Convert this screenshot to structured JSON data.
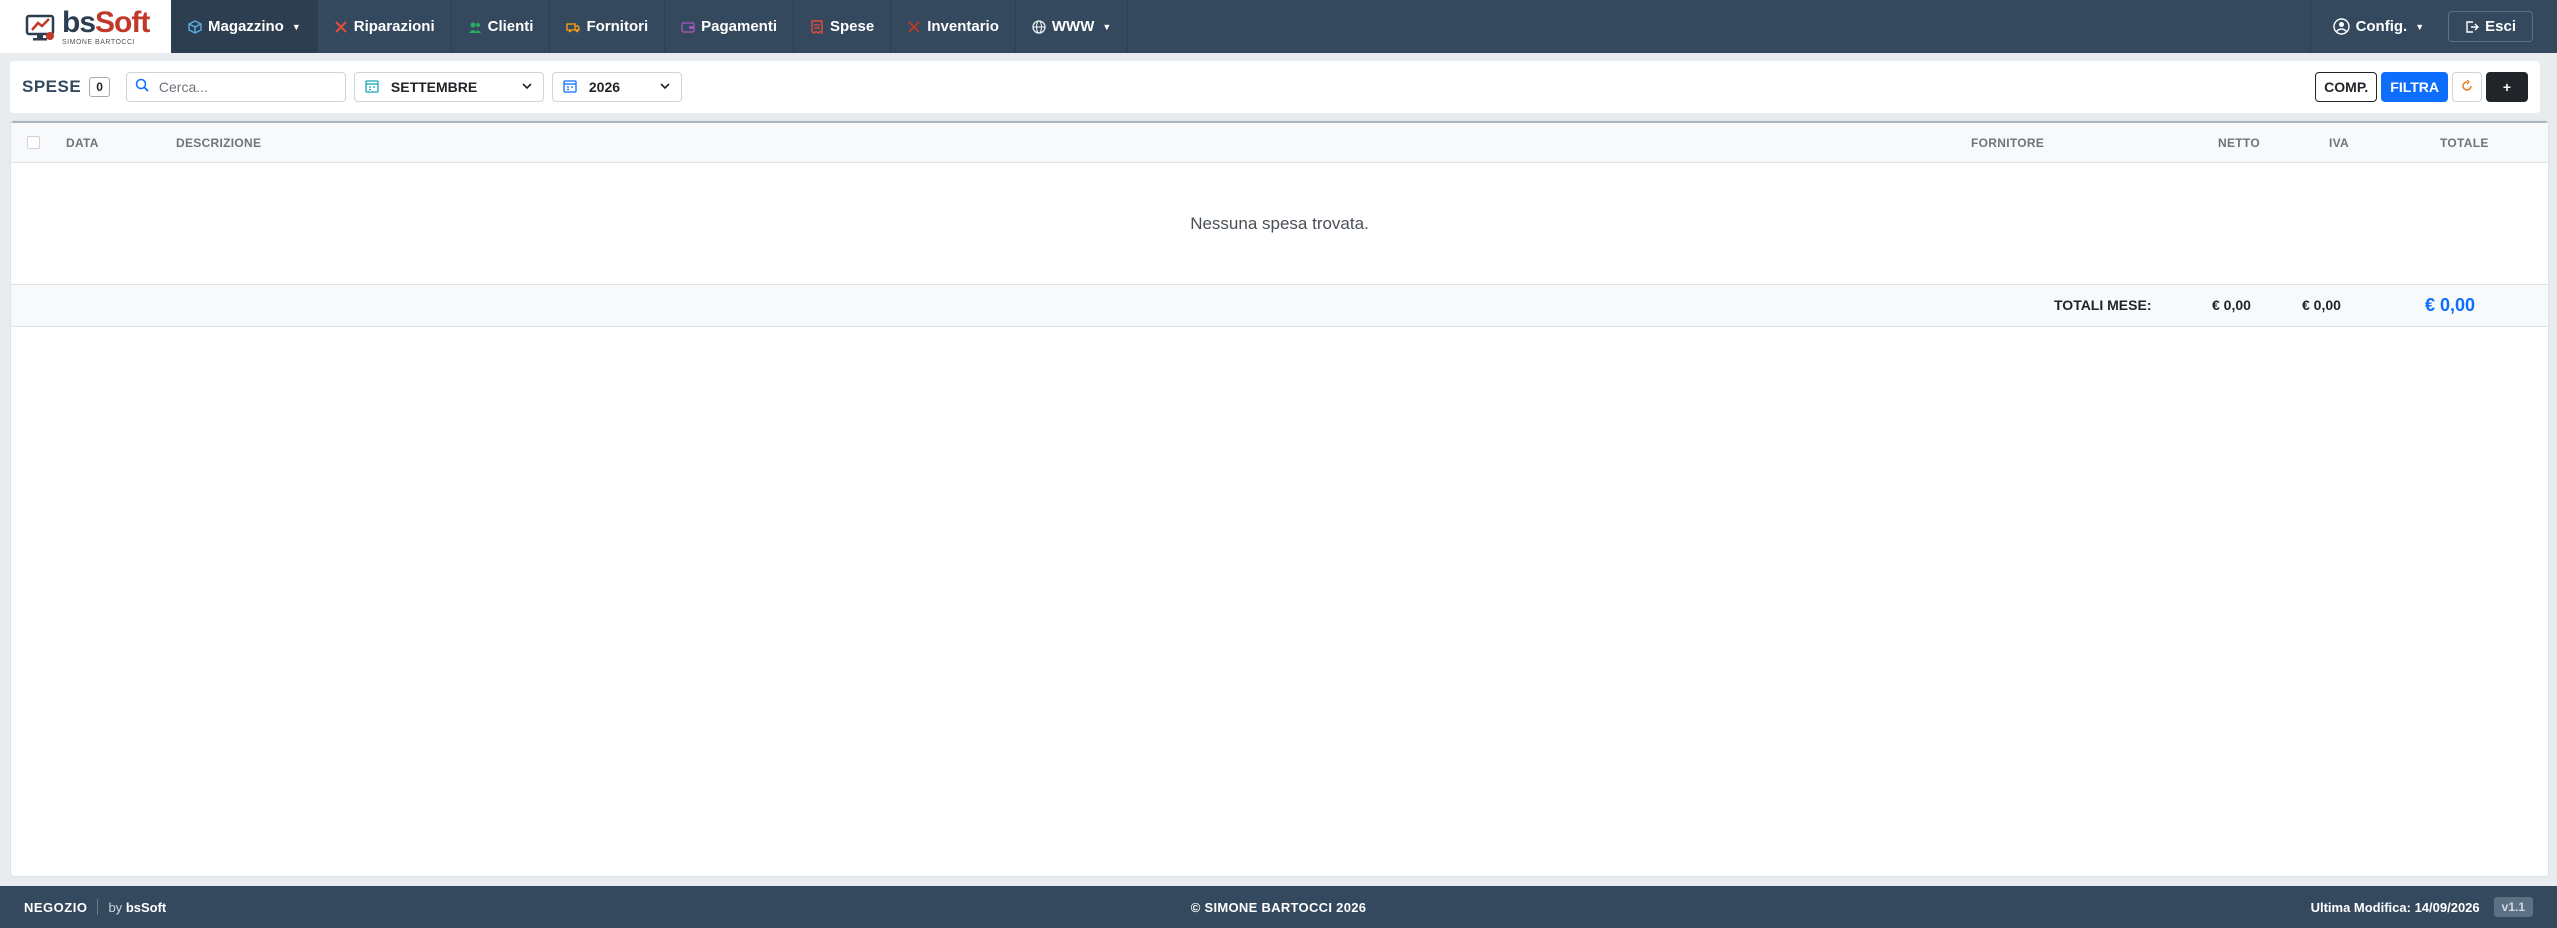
{
  "brand": {
    "name_bs": "bs",
    "name_soft": "Soft",
    "subtitle": "SIMONE BARTOCCI"
  },
  "nav": {
    "items": [
      {
        "label": "Magazzino",
        "icon": "box-icon",
        "color": "#5dade2",
        "caret": true
      },
      {
        "label": "Riparazioni",
        "icon": "tools-icon",
        "color": "#e74c3c",
        "caret": false
      },
      {
        "label": "Clienti",
        "icon": "people-icon",
        "color": "#27ae60",
        "caret": false
      },
      {
        "label": "Fornitori",
        "icon": "truck-icon",
        "color": "#f39c12",
        "caret": false
      },
      {
        "label": "Pagamenti",
        "icon": "wallet-icon",
        "color": "#9b59b6",
        "caret": false
      },
      {
        "label": "Spese",
        "icon": "receipt-icon",
        "color": "#e74c3c",
        "caret": false
      },
      {
        "label": "Inventario",
        "icon": "clipboard-icon",
        "color": "#c0392b",
        "caret": false
      },
      {
        "label": "WWW",
        "icon": "globe-icon",
        "color": "#ecf0f1",
        "caret": true
      }
    ],
    "config_label": "Config.",
    "logout_label": "Esci"
  },
  "toolbar": {
    "title": "SPESE",
    "count": "0",
    "search_placeholder": "Cerca...",
    "month": "SETTEMBRE",
    "year": "2026",
    "comp_label": "COMP.",
    "filtra_label": "FILTRA",
    "add_label": "+"
  },
  "table": {
    "headers": {
      "data": "DATA",
      "descrizione": "DESCRIZIONE",
      "fornitore": "FORNITORE",
      "netto": "NETTO",
      "iva": "IVA",
      "totale": "TOTALE"
    },
    "empty_message": "Nessuna spesa trovata.",
    "totals": {
      "label": "TOTALI MESE:",
      "netto": "€ 0,00",
      "iva": "€ 0,00",
      "totale": "€ 0,00"
    }
  },
  "footer": {
    "shop": "NEGOZIO",
    "by_prefix": "by",
    "by_brand": "bsSoft",
    "copyright": "© SIMONE BARTOCCI 2026",
    "last_modified": "Ultima Modifica: 14/09/2026",
    "version": "v1.1"
  },
  "colors": {
    "navbar": "#34495e",
    "primary": "#0d6efd",
    "dark": "#212529"
  }
}
